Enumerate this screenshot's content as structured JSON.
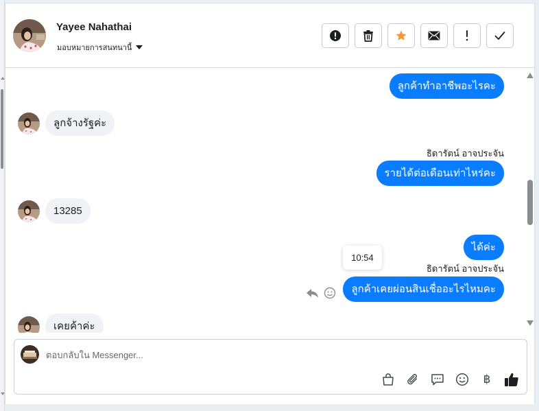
{
  "contact": {
    "name": "Yayee Nahathai",
    "assign_label": "มอบหมายการสนทนานี้"
  },
  "header_actions": [
    {
      "name": "spam-report-button",
      "icon": "alert-circle-icon"
    },
    {
      "name": "delete-button",
      "icon": "trash-icon"
    },
    {
      "name": "star-button",
      "icon": "star-icon"
    },
    {
      "name": "mark-unread-button",
      "icon": "envelope-icon"
    },
    {
      "name": "follow-up-button",
      "icon": "exclamation-icon"
    },
    {
      "name": "mark-done-button",
      "icon": "checkmark-icon"
    }
  ],
  "messages": [
    {
      "direction": "out",
      "text": "ลูกค้าทำอาชีพอะไรคะ"
    },
    {
      "direction": "in",
      "text": "ลูกจ้างรัฐค่ะ"
    },
    {
      "direction": "out",
      "sender": "ธิดารัตน์ อาจประจัน",
      "text": "รายได้ต่อเดือนเท่าไหร่คะ"
    },
    {
      "direction": "in",
      "text": "13285"
    },
    {
      "direction": "out",
      "text": "ได้ค่ะ"
    },
    {
      "direction": "out",
      "sender": "ธิดารัตน์ อาจประจัน",
      "text": "ลูกค้าเคยผ่อนสินเชื่ออะไรไหมคะ",
      "tooltip_time": "10:54"
    },
    {
      "direction": "in",
      "text": "เคยค้าค่ะ"
    }
  ],
  "composer": {
    "placeholder": "ตอบกลับใน Messenger...",
    "tools": [
      "shopping-bag-icon",
      "paperclip-icon",
      "saved-reply-icon",
      "emoji-icon",
      "baht-icon",
      "thumbs-up-icon"
    ],
    "baht_symbol": "฿"
  },
  "colors": {
    "outgoing_bubble": "#0a7cff",
    "incoming_bubble": "#f0f2f5",
    "star_active": "#f5943b"
  }
}
